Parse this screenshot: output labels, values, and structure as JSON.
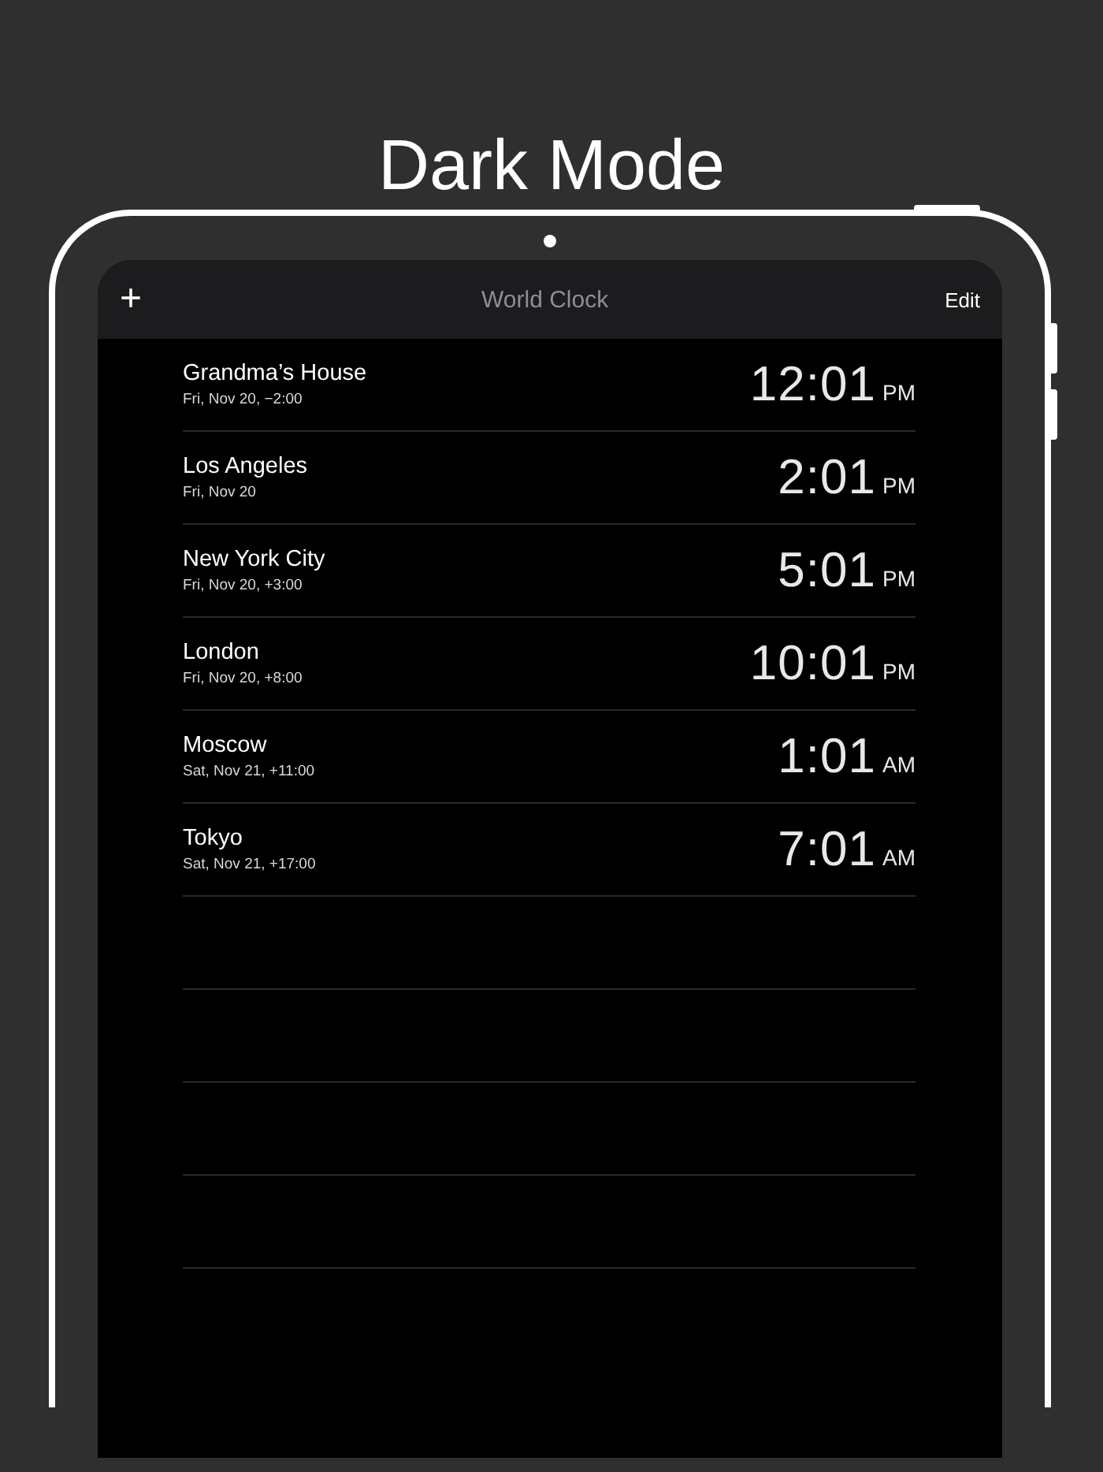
{
  "headline": "Dark Mode",
  "nav_bar": {
    "add": "+",
    "title": "World Clock",
    "edit": "Edit"
  },
  "clocks": [
    {
      "city": "Grandma’s House",
      "date": "Fri, Nov 20, −2:00",
      "time": "12:01",
      "period": "PM"
    },
    {
      "city": "Los Angeles",
      "date": "Fri, Nov 20",
      "time": "2:01",
      "period": "PM"
    },
    {
      "city": "New York City",
      "date": "Fri, Nov 20, +3:00",
      "time": "5:01",
      "period": "PM"
    },
    {
      "city": "London",
      "date": "Fri, Nov 20, +8:00",
      "time": "10:01",
      "period": "PM"
    },
    {
      "city": "Moscow",
      "date": "Sat, Nov 21, +11:00",
      "time": "1:01",
      "period": "AM"
    },
    {
      "city": "Tokyo",
      "date": "Sat, Nov 21, +17:00",
      "time": "7:01",
      "period": "AM"
    }
  ]
}
